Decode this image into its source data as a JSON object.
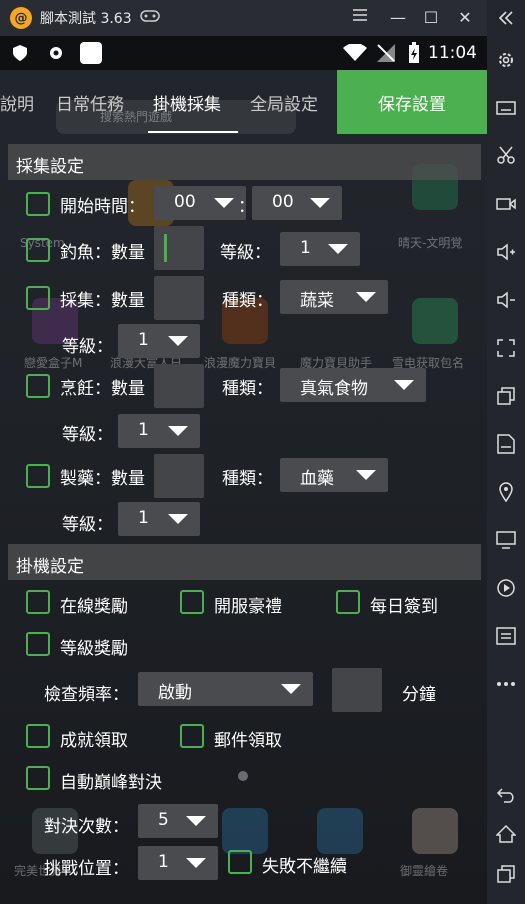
{
  "window": {
    "logo_glyph": "@",
    "title": "腳本測試 3.63",
    "minimize_label": "—",
    "maximize_label": "☐",
    "close_label": "✕"
  },
  "status_bar": {
    "time": "11:04"
  },
  "tabs": [
    {
      "label": "說明"
    },
    {
      "label": "日常任務"
    },
    {
      "label": "掛機採集"
    },
    {
      "label": "全局設定"
    }
  ],
  "save_button": "保存設置",
  "collect": {
    "section_title": "採集設定",
    "start_time": {
      "label": "開始時間：",
      "hour": "00",
      "colon": "：",
      "minute": "00"
    },
    "fishing": {
      "label": "釣魚：數量",
      "level_label": "等級：",
      "level": "1"
    },
    "gather": {
      "label": "採集：數量",
      "type_label": "種類：",
      "type": "蔬菜",
      "level_label": "等級：",
      "level": "1"
    },
    "cooking": {
      "label": "烹飪：數量",
      "type_label": "種類：",
      "type": "真氣食物",
      "level_label": "等級：",
      "level": "1"
    },
    "pharmacy": {
      "label": "製藥：數量",
      "type_label": "種類：",
      "type": "血藥",
      "level_label": "等級：",
      "level": "1"
    }
  },
  "idle": {
    "section_title": "掛機設定",
    "online_reward": "在線獎勵",
    "server_gift": "開服豪禮",
    "daily_checkin": "每日簽到",
    "level_reward": "等級獎勵",
    "check_freq_label": "檢查頻率：",
    "check_freq_value": "啟動",
    "minutes_label": "分鐘",
    "achievement_claim": "成就領取",
    "mail_claim": "郵件領取",
    "auto_peak_duel": "自動巔峰對決",
    "duel_count_label": "對決次數：",
    "duel_count": "5",
    "challenge_pos_label": "挑戰位置：",
    "challenge_pos": "1",
    "fail_stop": "失敗不繼續"
  },
  "background_apps": [
    {
      "label": "System"
    },
    {
      "label": "晴天-文明覚"
    },
    {
      "label": "戀愛盒子M"
    },
    {
      "label": "浪漫大富人日"
    },
    {
      "label": "浪漫魔力寶貝"
    },
    {
      "label": "魔力寶貝助手"
    },
    {
      "label": "雪电获取包名"
    },
    {
      "label": "完美世界"
    },
    {
      "label": "御靈繪卷"
    },
    {
      "label": "搜索熱門遊戲"
    }
  ],
  "colors": {
    "accent": "#4caf50",
    "section_bg": "#505050",
    "dropdown_bg": "#4a4b4f"
  }
}
